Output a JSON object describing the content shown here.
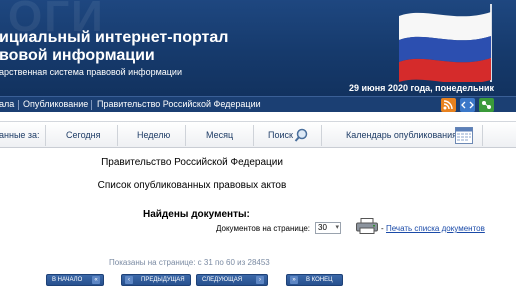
{
  "header": {
    "line1": "ициальный интернет-портал",
    "line2": "вовой информации",
    "line3": "арственная система правовой информации",
    "date": "29 июня 2020 года, понедельник",
    "watermark": "ОГИ"
  },
  "nav": {
    "items": [
      "ала",
      "Опубликование",
      "Правительство Российской Федерации"
    ]
  },
  "filter": {
    "label": "анные за:",
    "tabs": [
      "Сегодня",
      "Неделю",
      "Месяц",
      "Поиск",
      "Календарь опубликования"
    ]
  },
  "content": {
    "authority": "Правительство Российской Федерации",
    "list_title": "Список опубликованных правовых актов",
    "found_label": "Найдены документы:",
    "per_page_label": "Документов на странице:",
    "per_page_value": "30",
    "print_link": "Печать списка документов",
    "shown_text": "Показаны на странице: с 31 по 60 из 28453"
  },
  "pager": {
    "first": "В НАЧАЛО",
    "prev": "ПРЕДЫДУЩАЯ",
    "next": "СЛЕДУЮЩАЯ",
    "last": "В КОНЕЦ"
  },
  "colors": {
    "banner": "#163a6c",
    "nav": "#1b3f73",
    "link": "#1a4aa8",
    "button": "#27508e"
  }
}
